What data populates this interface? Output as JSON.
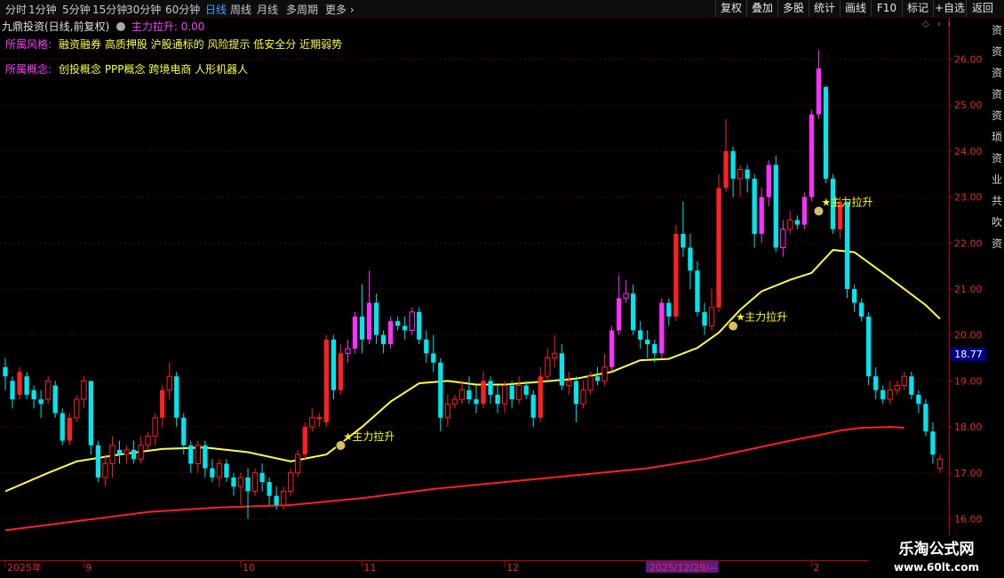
{
  "toolbar": {
    "periods": [
      "分时",
      "1分钟",
      "5分钟",
      "15分钟",
      "30分钟",
      "60分钟",
      "日线",
      "周线",
      "月线",
      "多周期",
      "更多"
    ],
    "active_period": "日线",
    "actions": [
      "复权",
      "叠加",
      "多股",
      "统计",
      "画线",
      "F10",
      "标记",
      "+自选",
      "返回"
    ]
  },
  "header": {
    "title": "九鼎投资(日线,前复权)",
    "indicator": "主力拉升: 0.00"
  },
  "info": {
    "style_label": "所属风格:",
    "style_value": "融资融券 高质押股 沪股通标的 风险提示 低安全分 近期弱势",
    "concept_label": "所属概念:",
    "concept_value": "创投概念 PPP概念 跨境电商 人形机器人"
  },
  "price_tag": "18.77",
  "watermark": {
    "line1": "乐淘公式网",
    "line2": "www.60lt.com"
  },
  "right_column": "资资资资资琐资业共吹资",
  "colors": {
    "up": "#ff2020",
    "down": "#00e5ee",
    "ma_short": "#ffff40",
    "ma_long": "#ff2020",
    "signal": "#ffff00",
    "axis": "#c00000"
  },
  "chart_data": {
    "type": "candlestick",
    "ylim": [
      15.1,
      26.9
    ],
    "yticks": [
      16.0,
      17.0,
      18.0,
      19.0,
      20.0,
      21.0,
      22.0,
      23.0,
      24.0,
      25.0,
      26.0
    ],
    "xticks": [
      {
        "label": "2025年",
        "index": 0
      },
      {
        "label": "9",
        "index": 11
      },
      {
        "label": "10",
        "index": 33
      },
      {
        "label": "11",
        "index": 50
      },
      {
        "label": "12",
        "index": 70
      },
      {
        "label": "2025/12/29/—",
        "index": 90
      },
      {
        "label": "2",
        "index": 113
      }
    ],
    "signal_label": "主力拉升",
    "signals": [
      {
        "index": 47,
        "price": 17.75
      },
      {
        "index": 102,
        "price": 20.35
      },
      {
        "index": 114,
        "price": 22.85
      }
    ],
    "candles": [
      [
        19.3,
        19.1,
        19.5,
        18.8
      ],
      [
        19.0,
        18.6,
        19.1,
        18.4
      ],
      [
        18.7,
        19.2,
        19.3,
        18.6
      ],
      [
        19.1,
        18.7,
        19.2,
        18.6
      ],
      [
        18.8,
        18.6,
        18.9,
        18.4
      ],
      [
        18.6,
        18.5,
        18.8,
        18.2
      ],
      [
        18.6,
        19.0,
        19.1,
        18.5
      ],
      [
        18.9,
        18.3,
        19.0,
        18.2
      ],
      [
        18.3,
        17.7,
        18.4,
        17.6
      ],
      [
        17.7,
        18.2,
        18.3,
        17.6
      ],
      [
        18.2,
        18.6,
        18.7,
        18.1
      ],
      [
        18.6,
        19.0,
        19.1,
        18.4
      ],
      [
        19.0,
        17.6,
        19.0,
        17.4
      ],
      [
        17.6,
        16.9,
        17.7,
        16.8
      ],
      [
        16.9,
        17.2,
        17.4,
        16.7
      ],
      [
        17.2,
        17.6,
        17.8,
        16.9
      ],
      [
        17.5,
        17.4,
        17.7,
        17.2
      ],
      [
        17.4,
        17.5,
        17.6,
        17.2
      ],
      [
        17.5,
        17.3,
        17.7,
        17.2
      ],
      [
        17.3,
        17.6,
        17.8,
        17.2
      ],
      [
        17.6,
        17.8,
        17.9,
        17.5
      ],
      [
        17.8,
        18.2,
        18.3,
        17.6
      ],
      [
        18.2,
        18.8,
        18.9,
        18.0
      ],
      [
        18.8,
        19.1,
        19.4,
        18.6
      ],
      [
        19.1,
        18.2,
        19.2,
        18.0
      ],
      [
        18.2,
        17.6,
        18.3,
        17.4
      ],
      [
        17.6,
        17.2,
        17.7,
        17.0
      ],
      [
        17.2,
        17.6,
        17.7,
        17.0
      ],
      [
        17.6,
        17.1,
        17.7,
        16.9
      ],
      [
        17.1,
        16.9,
        17.3,
        16.8
      ],
      [
        16.9,
        17.2,
        17.3,
        16.7
      ],
      [
        17.2,
        16.9,
        17.3,
        16.8
      ],
      [
        16.9,
        16.7,
        17.0,
        16.5
      ],
      [
        16.7,
        16.9,
        17.0,
        16.3
      ],
      [
        16.9,
        16.6,
        17.1,
        16.0
      ],
      [
        16.6,
        17.0,
        17.1,
        16.5
      ],
      [
        17.0,
        16.8,
        17.2,
        16.6
      ],
      [
        16.8,
        16.5,
        16.9,
        16.3
      ],
      [
        16.5,
        16.3,
        16.7,
        16.2
      ],
      [
        16.3,
        16.6,
        16.7,
        16.2
      ],
      [
        16.6,
        17.0,
        17.1,
        16.5
      ],
      [
        17.0,
        17.4,
        17.5,
        16.9
      ],
      [
        17.4,
        18.0,
        18.1,
        17.3
      ],
      [
        18.0,
        18.2,
        18.4,
        17.9
      ],
      [
        18.2,
        18.2,
        18.3,
        18.0
      ],
      [
        18.1,
        19.9,
        20.0,
        18.0
      ],
      [
        19.9,
        18.8,
        20.0,
        18.6
      ],
      [
        18.8,
        19.6,
        19.8,
        18.7
      ],
      [
        19.6,
        19.7,
        19.9,
        19.4
      ],
      [
        19.7,
        20.4,
        20.5,
        19.6
      ],
      [
        20.4,
        19.9,
        21.1,
        19.6
      ],
      [
        19.9,
        20.7,
        21.4,
        19.8
      ],
      [
        20.7,
        20.0,
        20.9,
        19.8
      ],
      [
        20.0,
        19.8,
        20.1,
        19.6
      ],
      [
        19.8,
        20.3,
        20.4,
        19.7
      ],
      [
        20.3,
        20.2,
        20.4,
        20.1
      ],
      [
        20.2,
        20.1,
        20.4,
        19.9
      ],
      [
        20.1,
        20.5,
        20.6,
        20.0
      ],
      [
        20.5,
        19.9,
        20.6,
        19.8
      ],
      [
        19.9,
        19.6,
        20.1,
        19.4
      ],
      [
        19.6,
        19.4,
        20.0,
        19.2
      ],
      [
        19.4,
        18.2,
        19.5,
        17.9
      ],
      [
        18.2,
        18.5,
        18.7,
        18.0
      ],
      [
        18.5,
        18.6,
        18.7,
        18.4
      ],
      [
        18.6,
        18.8,
        19.0,
        18.5
      ],
      [
        18.8,
        18.6,
        19.1,
        18.5
      ],
      [
        18.6,
        18.5,
        18.9,
        18.3
      ],
      [
        18.5,
        19.0,
        19.2,
        18.4
      ],
      [
        19.0,
        18.7,
        19.1,
        18.5
      ],
      [
        18.7,
        18.5,
        18.9,
        18.3
      ],
      [
        18.5,
        18.9,
        19.0,
        18.3
      ],
      [
        18.9,
        18.6,
        19.0,
        18.4
      ],
      [
        18.6,
        18.9,
        19.1,
        18.5
      ],
      [
        18.9,
        18.7,
        19.0,
        18.6
      ],
      [
        18.7,
        18.2,
        18.8,
        18.0
      ],
      [
        18.2,
        19.1,
        19.3,
        18.1
      ],
      [
        19.1,
        19.5,
        19.7,
        19.0
      ],
      [
        19.5,
        19.6,
        20.0,
        19.3
      ],
      [
        19.6,
        18.9,
        19.8,
        18.8
      ],
      [
        18.9,
        19.0,
        19.2,
        18.7
      ],
      [
        19.0,
        18.5,
        19.1,
        18.1
      ],
      [
        18.5,
        18.8,
        19.0,
        18.4
      ],
      [
        18.8,
        19.1,
        19.2,
        18.7
      ],
      [
        19.1,
        19.0,
        19.3,
        18.9
      ],
      [
        19.0,
        19.3,
        19.6,
        18.9
      ],
      [
        19.3,
        20.1,
        20.2,
        19.2
      ],
      [
        20.1,
        20.8,
        21.3,
        20.0
      ],
      [
        20.8,
        20.9,
        21.2,
        20.7
      ],
      [
        20.9,
        20.1,
        21.1,
        20.0
      ],
      [
        20.1,
        19.9,
        20.3,
        19.7
      ],
      [
        19.9,
        19.8,
        20.1,
        19.5
      ],
      [
        19.8,
        19.6,
        19.9,
        19.4
      ],
      [
        19.6,
        20.7,
        20.8,
        19.5
      ],
      [
        20.7,
        20.4,
        20.8,
        20.2
      ],
      [
        20.4,
        22.2,
        22.4,
        20.3
      ],
      [
        22.2,
        21.9,
        22.9,
        21.7
      ],
      [
        21.9,
        21.4,
        22.2,
        21.0
      ],
      [
        21.4,
        20.5,
        21.6,
        20.4
      ],
      [
        20.5,
        20.2,
        20.7,
        20.0
      ],
      [
        20.2,
        20.6,
        21.0,
        20.1
      ],
      [
        20.6,
        23.2,
        23.5,
        20.5
      ],
      [
        23.2,
        24.0,
        24.7,
        23.1
      ],
      [
        24.0,
        23.4,
        24.1,
        23.0
      ],
      [
        23.4,
        23.6,
        23.7,
        23.0
      ],
      [
        23.6,
        23.4,
        23.7,
        23.1
      ],
      [
        23.4,
        22.2,
        23.5,
        21.9
      ],
      [
        22.2,
        23.0,
        23.2,
        22.0
      ],
      [
        23.0,
        23.7,
        23.8,
        22.8
      ],
      [
        23.7,
        21.9,
        23.9,
        21.8
      ],
      [
        21.9,
        22.3,
        22.5,
        21.7
      ],
      [
        22.3,
        22.5,
        22.7,
        22.2
      ],
      [
        22.5,
        22.4,
        22.6,
        22.3
      ],
      [
        22.4,
        23.0,
        23.1,
        22.3
      ],
      [
        23.0,
        24.8,
        24.9,
        22.9
      ],
      [
        24.8,
        25.8,
        26.2,
        24.7
      ],
      [
        25.4,
        23.4,
        24.2,
        23.3
      ],
      [
        23.4,
        22.3,
        23.5,
        22.2
      ],
      [
        22.3,
        22.9,
        23.0,
        22.1
      ],
      [
        22.9,
        21.0,
        22.9,
        20.8
      ],
      [
        21.0,
        20.7,
        21.1,
        20.5
      ],
      [
        20.7,
        20.4,
        20.8,
        20.3
      ],
      [
        20.4,
        19.1,
        20.5,
        18.9
      ],
      [
        19.1,
        18.8,
        19.3,
        18.6
      ],
      [
        18.8,
        18.6,
        18.9,
        18.5
      ],
      [
        18.6,
        18.8,
        19.0,
        18.5
      ],
      [
        18.8,
        18.9,
        19.0,
        18.7
      ],
      [
        18.9,
        19.1,
        19.2,
        18.8
      ],
      [
        19.1,
        18.7,
        19.2,
        18.6
      ],
      [
        18.7,
        18.5,
        18.8,
        18.3
      ],
      [
        18.5,
        17.9,
        18.6,
        17.8
      ],
      [
        17.9,
        17.4,
        18.1,
        17.2
      ],
      [
        17.1,
        17.3,
        17.4,
        17.0
      ]
    ],
    "ma_short": [
      [
        0,
        16.6
      ],
      [
        6,
        17.0
      ],
      [
        10,
        17.25
      ],
      [
        16,
        17.4
      ],
      [
        22,
        17.52
      ],
      [
        28,
        17.55
      ],
      [
        34,
        17.45
      ],
      [
        40,
        17.25
      ],
      [
        45,
        17.4
      ],
      [
        50,
        18.0
      ],
      [
        54,
        18.55
      ],
      [
        58,
        18.95
      ],
      [
        62,
        19.0
      ],
      [
        66,
        18.92
      ],
      [
        70,
        18.92
      ],
      [
        75,
        18.98
      ],
      [
        80,
        19.05
      ],
      [
        85,
        19.2
      ],
      [
        89,
        19.45
      ],
      [
        93,
        19.48
      ],
      [
        97,
        19.72
      ],
      [
        100,
        20.05
      ],
      [
        103,
        20.55
      ],
      [
        106,
        20.95
      ],
      [
        110,
        21.2
      ],
      [
        113,
        21.35
      ],
      [
        116,
        21.85
      ],
      [
        119,
        21.8
      ],
      [
        123,
        21.35
      ],
      [
        126,
        21.0
      ],
      [
        129,
        20.65
      ],
      [
        131,
        20.35
      ]
    ],
    "ma_long": [
      [
        0,
        15.75
      ],
      [
        10,
        15.95
      ],
      [
        20,
        16.15
      ],
      [
        30,
        16.25
      ],
      [
        40,
        16.3
      ],
      [
        50,
        16.45
      ],
      [
        60,
        16.65
      ],
      [
        70,
        16.8
      ],
      [
        80,
        16.95
      ],
      [
        90,
        17.1
      ],
      [
        98,
        17.3
      ],
      [
        104,
        17.5
      ],
      [
        110,
        17.7
      ],
      [
        114,
        17.82
      ],
      [
        117,
        17.92
      ],
      [
        120,
        17.98
      ],
      [
        124,
        18.0
      ],
      [
        126,
        17.98
      ]
    ]
  }
}
